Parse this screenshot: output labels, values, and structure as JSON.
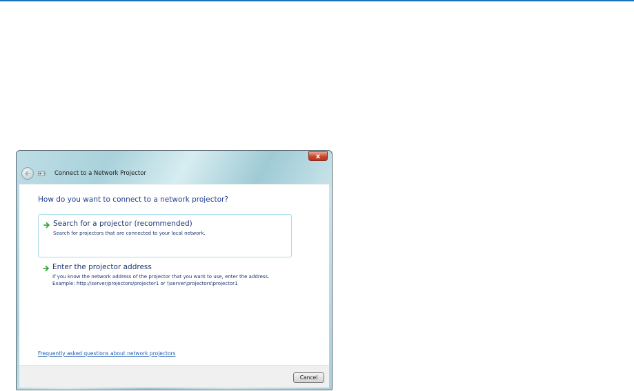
{
  "window": {
    "title": "Connect to a Network Projector",
    "close_label": "x"
  },
  "question": "How do you want to connect to a network projector?",
  "options": [
    {
      "title": "Search for a projector (recommended)",
      "description": [
        "Search for projectors that are connected to your local network."
      ]
    },
    {
      "title": "Enter the projector address",
      "description": [
        "If you know the network address of the projector that you want to use, enter the address.",
        "Example: http://server/projectors/projector1 or \\\\server\\projectors\\projector1"
      ]
    }
  ],
  "faq_link": "Frequently asked questions about network projectors",
  "footer": {
    "cancel_label": "Cancel"
  },
  "colors": {
    "accent_rule": "#1d72b8",
    "heading_text": "#1f3e8c",
    "link": "#1e5cb3",
    "option_border": "#a8dced",
    "arrow": "#3aa53a"
  },
  "icons": {
    "back": "back-arrow-icon",
    "app": "network-projector-icon",
    "option_arrow": "green-arrow-icon",
    "close": "close-icon"
  }
}
